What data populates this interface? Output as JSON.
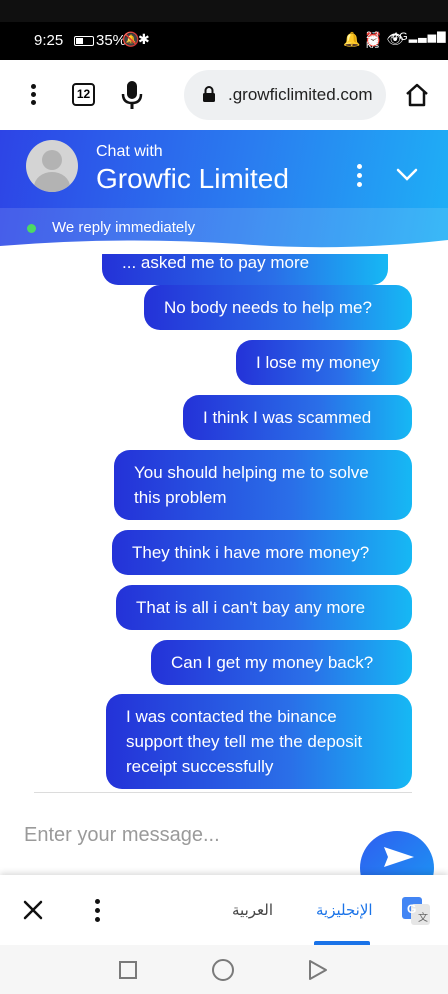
{
  "status": {
    "time": "9:25",
    "battery": "35%",
    "speed_value": "2.3",
    "speed_unit": "K/s",
    "network": "4G"
  },
  "browser": {
    "tab_count": "12",
    "url": ".growficlimited.com"
  },
  "chat": {
    "chat_with_label": "Chat with",
    "company_name": "Growfic Limited",
    "reply_status": "We reply immediately",
    "messages": [
      "... asked me to pay more",
      "No body needs to help me?",
      "I lose my money",
      "I think I was scammed",
      "You should helping me to solve this problem",
      "They think i have more money?",
      "That is all i can't bay any more",
      "Can I get my money back?",
      "I was contacted the binance support they tell me the deposit receipt successfully"
    ],
    "input_placeholder": "Enter your message..."
  },
  "translate": {
    "lang_arabic": "العربية",
    "lang_english": "الإنجليزية"
  },
  "colors": {
    "accent_blue": "#2a6fe8",
    "online_green": "#4cd964",
    "translate_blue": "#1a73e8"
  }
}
